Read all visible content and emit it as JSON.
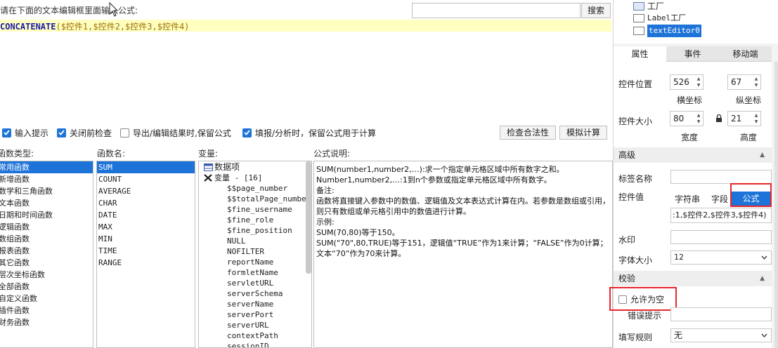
{
  "editor": {
    "prompt": "请在下面的文本编辑框里面输入公式:",
    "search_button": "搜索",
    "formula_fn": "CONCATENATE",
    "formula_args": "($控件1,$控件2,$控件3,$控件4)"
  },
  "options": {
    "input_hint": "输入提示",
    "check_before_close": "关闭前检查",
    "export_keep_formula": "导出/编辑结果时,保留公式",
    "fill_keep_formula": "填报/分析时，保留公式用于计算",
    "check_validity": "检查合法性",
    "simulate_calc": "模拟计算"
  },
  "columns": {
    "function_type": "函数类型:",
    "function_name": "函数名:",
    "variable": "变量:",
    "formula_desc": "公式说明:"
  },
  "function_types": [
    "常用函数",
    "新增函数",
    "数学和三角函数",
    "文本函数",
    "日期和时间函数",
    "逻辑函数",
    "数组函数",
    "报表函数",
    "其它函数",
    "层次坐标函数",
    "全部函数",
    "自定义函数",
    "插件函数",
    "财务函数"
  ],
  "function_names": [
    "SUM",
    "COUNT",
    "AVERAGE",
    "CHAR",
    "DATE",
    "MAX",
    "MIN",
    "TIME",
    "RANGE"
  ],
  "variables": {
    "data_item": "数据项",
    "var_group": "变量 - [16]",
    "items": [
      "$$page_number",
      "$$totalPage_number",
      "$fine_username",
      "$fine_role",
      "$fine_position",
      "NULL",
      "NOFILTER",
      "reportName",
      "formletName",
      "servletURL",
      "serverSchema",
      "serverName",
      "serverPort",
      "serverURL",
      "contextPath",
      "sessionID"
    ]
  },
  "description": [
    "SUM(number1,number2,…):求一个指定单元格区域中所有数字之和。",
    "Number1,number2,…:1到n个参数或指定单元格区域中所有数字。",
    "备注:",
    "函数将直接键入参数中的数值、逻辑值及文本表达式计算在内。若参数是数组或引用，则只有数组或单元格引用中的数值进行计算。",
    "示例:",
    "SUM(70,80)等于150。",
    "SUM(\"70\",80,TRUE)等于151，逻辑值“TRUE”作为1来计算；“FALSE”作为0计算；文本“70”作为70来计算。"
  ],
  "tree": {
    "items": [
      "工厂",
      "Label工厂",
      "textEditor0"
    ]
  },
  "panel": {
    "tabs": [
      "属性",
      "事件",
      "移动端"
    ],
    "position_label": "控件位置",
    "pos_x": "526",
    "pos_y": "67",
    "x_label": "横坐标",
    "y_label": "纵坐标",
    "size_label": "控件大小",
    "width": "80",
    "height": "21",
    "width_label": "宽度",
    "height_label": "高度",
    "advanced": "高级",
    "tag_name": "标签名称",
    "control_value": "控件值",
    "value_types": [
      "字符串",
      "字段",
      "公式"
    ],
    "value_formula": ":1,$控件2,$控件3,$控件4)",
    "watermark": "水印",
    "font_size_label": "字体大小",
    "font_size": "12",
    "validation": "校验",
    "allow_empty": "允许为空",
    "error_hint": "错误提示",
    "fill_rule_label": "填写规则",
    "fill_rule": "无"
  },
  "colors": {
    "selection": "#1e73d8",
    "highlight_red": "#e8262b",
    "editor_bg": "#ffffc0"
  }
}
